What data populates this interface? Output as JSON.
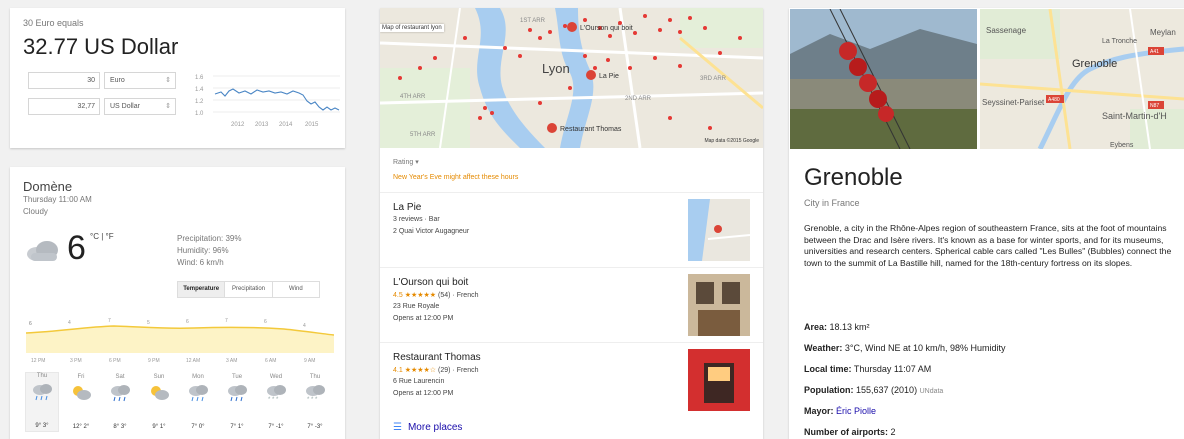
{
  "converter": {
    "caption": "30 Euro equals",
    "result": "32.77 US Dollar",
    "from_amount": "30",
    "from_currency": "Euro",
    "to_amount": "32,77",
    "to_currency": "US Dollar",
    "chart_y_ticks": [
      "1.6",
      "1.4",
      "1.2",
      "1.0"
    ],
    "chart_x_ticks": [
      "2012",
      "2013",
      "2014",
      "2015"
    ]
  },
  "weather": {
    "location": "Domène",
    "day_time": "Thursday 11:00 AM",
    "condition": "Cloudy",
    "temp": "6",
    "units": "°C | °F",
    "precipitation": "Precipitation: 39%",
    "humidity": "Humidity: 96%",
    "wind": "Wind: 6 km/h",
    "tabs": [
      "Temperature",
      "Precipitation",
      "Wind"
    ],
    "hours": [
      "12 PM",
      "3 PM",
      "6 PM",
      "9 PM",
      "12 AM",
      "3 AM",
      "6 AM",
      "9 AM"
    ],
    "chart_points": [
      "6",
      "4",
      "7",
      "5",
      "6",
      "7",
      "6",
      "4"
    ],
    "forecast": [
      {
        "day": "Thu",
        "icon": "rain-icon",
        "temps": "9° 3°"
      },
      {
        "day": "Fri",
        "icon": "partly-sunny-icon",
        "temps": "12° 2°"
      },
      {
        "day": "Sat",
        "icon": "rain-icon",
        "temps": "8° 3°"
      },
      {
        "day": "Sun",
        "icon": "partly-sunny-icon",
        "temps": "9° 1°"
      },
      {
        "day": "Mon",
        "icon": "rain-icon",
        "temps": "7° 0°"
      },
      {
        "day": "Tue",
        "icon": "rain-icon",
        "temps": "7° 1°"
      },
      {
        "day": "Wed",
        "icon": "snow-icon",
        "temps": "7° -1°"
      },
      {
        "day": "Thu",
        "icon": "snow-icon",
        "temps": "7° -3°"
      }
    ]
  },
  "places": {
    "map_label": "Map of restaurant lyon",
    "map_data": "Map data ©2015 Google",
    "map_city": "Lyon",
    "map_pins": [
      "L'Ourson qui boit",
      "La Pie",
      "Restaurant Thomas"
    ],
    "map_districts": [
      "1ST ARR",
      "4TH ARR",
      "2ND ARR",
      "3RD ARR",
      "5TH ARR"
    ],
    "rating_label": "Rating",
    "warning": "New Year's Eve might affect these hours",
    "list": [
      {
        "name": "La Pie",
        "line2": "3 reviews · Bar",
        "line3": "2 Quai Victor Augagneur",
        "line4": "",
        "score": "",
        "stars": "",
        "count_type": ""
      },
      {
        "name": "L'Ourson qui boit",
        "line2": "",
        "line3": "23 Rue Royale",
        "line4": "Opens at 12:00 PM",
        "score": "4.5",
        "stars": "★★★★★",
        "count_type": "(54) · French"
      },
      {
        "name": "Restaurant Thomas",
        "line2": "",
        "line3": "6 Rue Laurencin",
        "line4": "Opens at 12:00 PM",
        "score": "4.1",
        "stars": "★★★★☆",
        "count_type": "(29) · French"
      }
    ],
    "more": "More places"
  },
  "grenoble": {
    "title": "Grenoble",
    "subtitle": "City in France",
    "description": "Grenoble, a city in the Rhône-Alpes region of southeastern France, sits at the foot of mountains between the Drac and Isère rivers. It's known as a base for winter sports, and for its museums, universities and research centers. Spherical cable cars called \"Les Bulles\" (Bubbles) connect the town to the summit of La Bastille hill, named for the 18th-century fortress on its slopes.",
    "map_labels": [
      "Sassenage",
      "La Tronche",
      "Meylan",
      "Grenoble",
      "Seyssinet-Pariset",
      "Saint-Martin-d'H",
      "Eybens"
    ],
    "map_roads": [
      "A41",
      "A480",
      "N87"
    ],
    "facts": [
      {
        "label": "Area:",
        "value": "18.13 km²",
        "link": "",
        "source": ""
      },
      {
        "label": "Weather:",
        "value": "3°C, Wind NE at 10 km/h, 98% Humidity",
        "link": "",
        "source": ""
      },
      {
        "label": "Local time:",
        "value": "Thursday 11:07 AM",
        "link": "",
        "source": ""
      },
      {
        "label": "Population:",
        "value": "155,637 (2010)",
        "link": "",
        "source": "UNdata"
      },
      {
        "label": "Mayor:",
        "value": "",
        "link": "Éric Piolle",
        "source": ""
      },
      {
        "label": "Number of airports:",
        "value": "2",
        "link": "",
        "source": ""
      }
    ]
  }
}
